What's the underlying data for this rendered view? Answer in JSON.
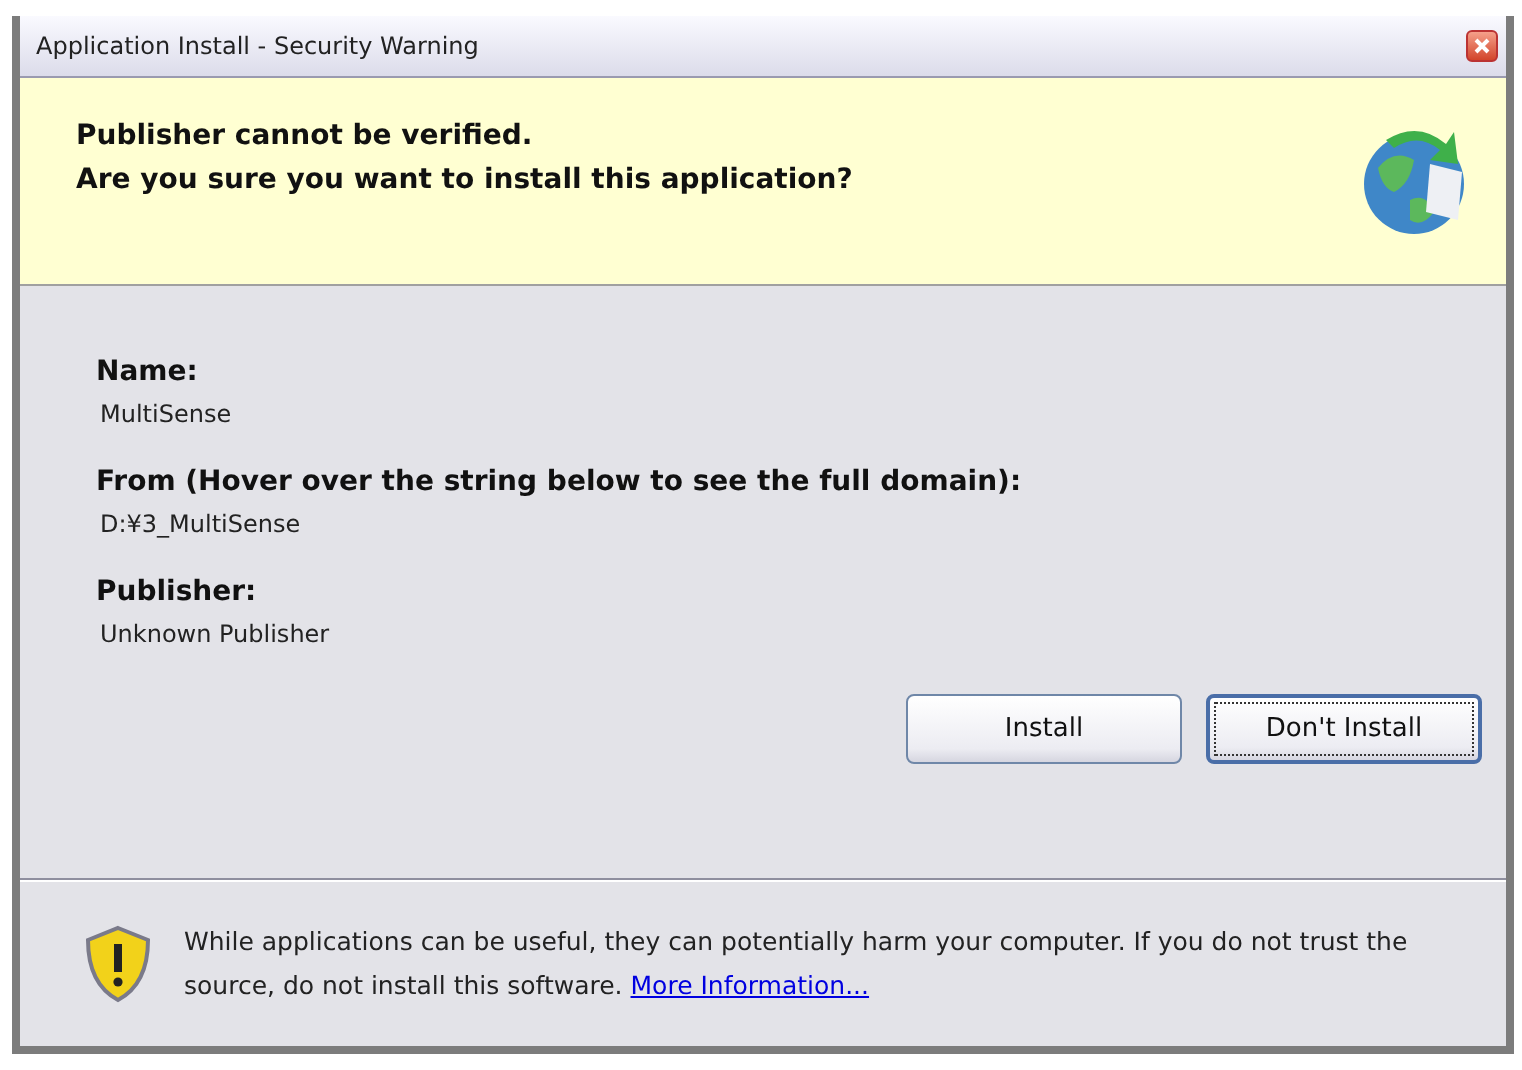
{
  "window": {
    "title": "Application Install - Security Warning"
  },
  "header": {
    "lines": [
      "Publisher cannot be verified.",
      "Are you sure you want to install this application?"
    ]
  },
  "details": [
    {
      "label": "Name:",
      "value": "MultiSense"
    },
    {
      "label": "From (Hover over the string below to see the full domain):",
      "value": "D:¥3_MultiSense"
    },
    {
      "label": "Publisher:",
      "value": "Unknown Publisher"
    }
  ],
  "buttons": [
    {
      "label": "Install",
      "focused": false
    },
    {
      "label": "Don't Install",
      "focused": true
    }
  ],
  "footer": {
    "text": "While applications can be useful, they can potentially harm your computer. If you do not trust the source, do not install this software.",
    "link": "More Information..."
  }
}
